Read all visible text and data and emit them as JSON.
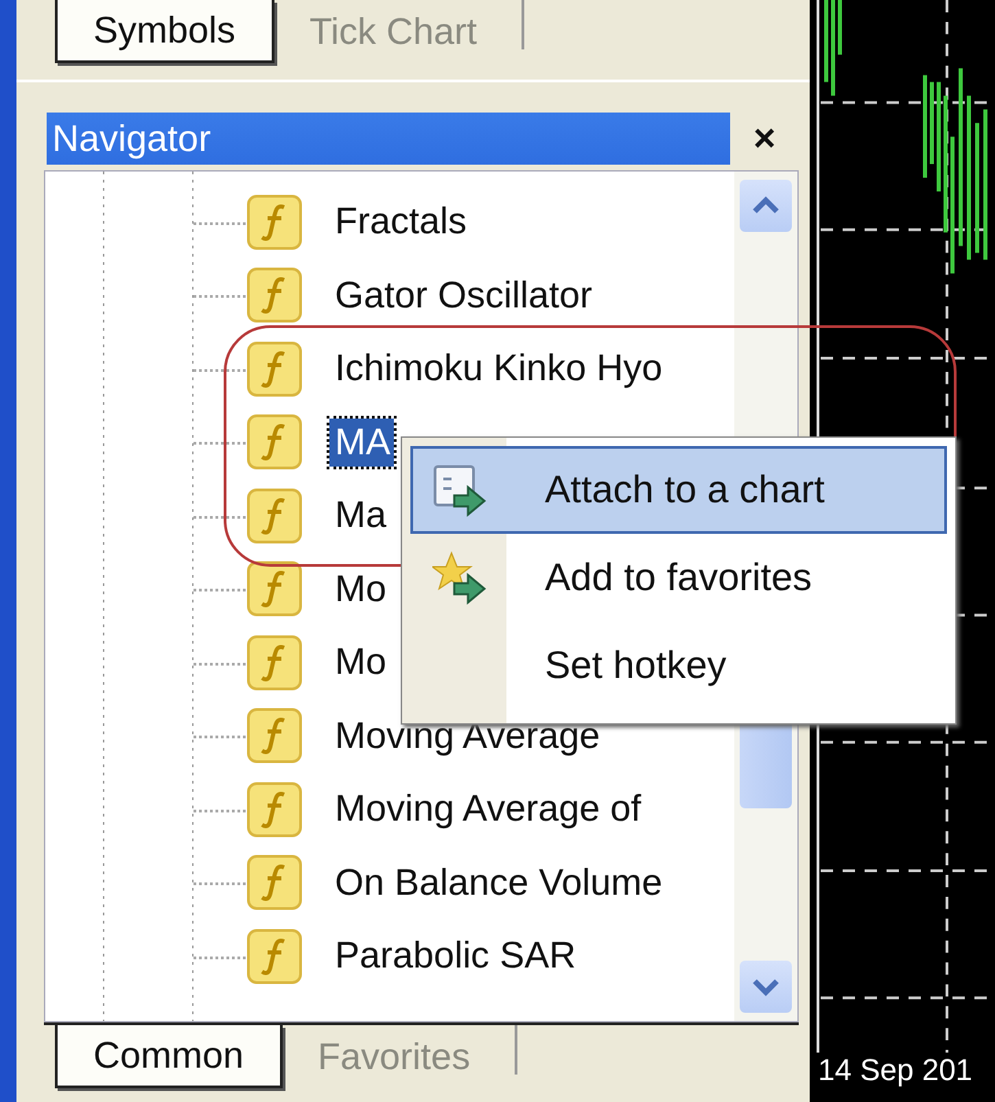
{
  "top_tabs": [
    {
      "label": "Symbols",
      "selected": true
    },
    {
      "label": "Tick Chart",
      "selected": false
    }
  ],
  "navigator": {
    "title": "Navigator",
    "close": "×",
    "items": [
      {
        "label": "Fractals",
        "selected": false
      },
      {
        "label": "Gator Oscillator",
        "selected": false
      },
      {
        "label": "Ichimoku Kinko Hyo",
        "selected": false
      },
      {
        "label": "MA",
        "selected": true
      },
      {
        "label": "Ma",
        "selected": false
      },
      {
        "label": "Mo",
        "selected": false
      },
      {
        "label": "Mo",
        "selected": false
      },
      {
        "label": "Moving Average",
        "selected": false
      },
      {
        "label": "Moving Average of",
        "selected": false
      },
      {
        "label": "On Balance Volume",
        "selected": false
      },
      {
        "label": "Parabolic SAR",
        "selected": false
      }
    ]
  },
  "context_menu": {
    "items": [
      {
        "label": "Attach to a chart",
        "kind": "attach",
        "selected": true
      },
      {
        "label": "Add to favorites",
        "kind": "favorite",
        "selected": false
      },
      {
        "label": "Set hotkey",
        "kind": "plain",
        "selected": false
      }
    ]
  },
  "bottom_tabs": [
    {
      "label": "Common",
      "selected": true
    },
    {
      "label": "Favorites",
      "selected": false
    }
  ],
  "chart": {
    "date_label": "14 Sep 201"
  }
}
